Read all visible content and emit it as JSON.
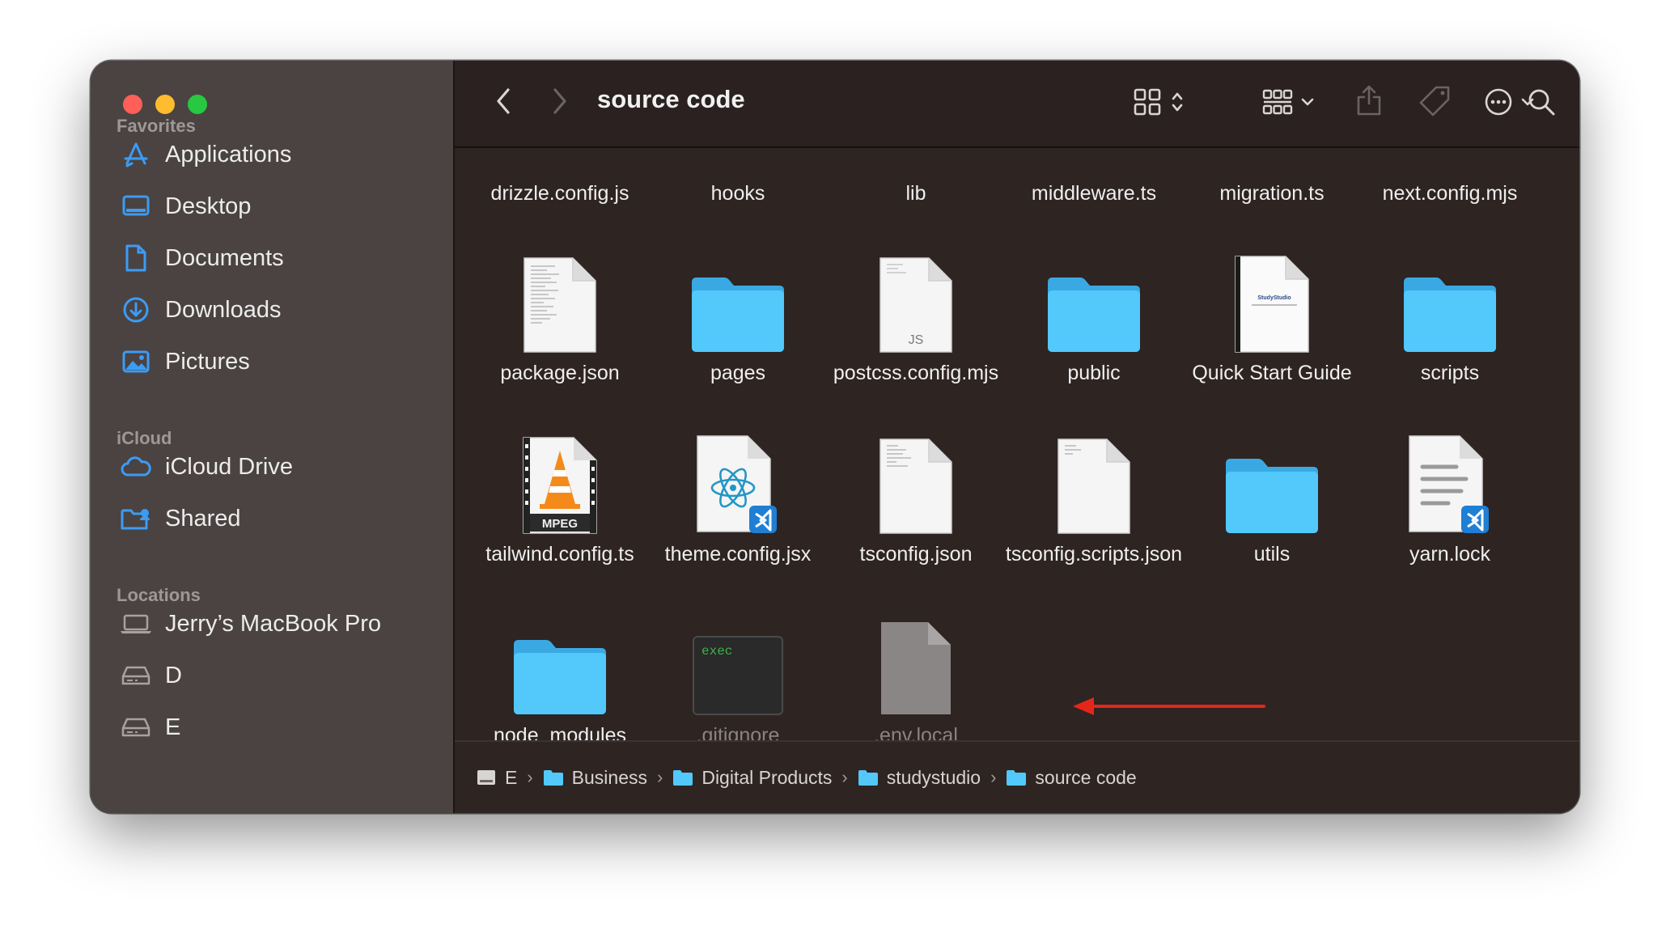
{
  "window": {
    "title": "source code"
  },
  "sidebar": {
    "sections": [
      {
        "heading": "Favorites",
        "items": [
          {
            "label": "Applications",
            "icon": "applications-icon"
          },
          {
            "label": "Desktop",
            "icon": "desktop-icon"
          },
          {
            "label": "Documents",
            "icon": "documents-icon"
          },
          {
            "label": "Downloads",
            "icon": "downloads-icon"
          },
          {
            "label": "Pictures",
            "icon": "pictures-icon"
          }
        ]
      },
      {
        "heading": "iCloud",
        "items": [
          {
            "label": "iCloud Drive",
            "icon": "icloud-icon"
          },
          {
            "label": "Shared",
            "icon": "shared-folder-icon"
          }
        ]
      },
      {
        "heading": "Locations",
        "items": [
          {
            "label": "Jerry’s MacBook Pro",
            "icon": "laptop-icon"
          },
          {
            "label": "D",
            "icon": "drive-icon"
          },
          {
            "label": "E",
            "icon": "drive-icon"
          }
        ]
      }
    ]
  },
  "files": {
    "row0": [
      "drizzle.config.js",
      "hooks",
      "lib",
      "middleware.ts",
      "migration.ts",
      "next.config.mjs"
    ],
    "row1": [
      {
        "name": "package.json",
        "kind": "text-document"
      },
      {
        "name": "pages",
        "kind": "folder"
      },
      {
        "name": "postcss.config.mjs",
        "kind": "js-document",
        "badge": "JS"
      },
      {
        "name": "public",
        "kind": "folder"
      },
      {
        "name": "Quick Start Guide",
        "kind": "pdf-preview",
        "preview_text": "StudyStudio"
      },
      {
        "name": "scripts",
        "kind": "folder"
      }
    ],
    "row2": [
      {
        "name": "tailwind.config.ts",
        "kind": "mpeg-video",
        "badge": "MPEG"
      },
      {
        "name": "theme.config.jsx",
        "kind": "react-file"
      },
      {
        "name": "tsconfig.json",
        "kind": "text-document"
      },
      {
        "name": "tsconfig.scripts.json",
        "kind": "text-document"
      },
      {
        "name": "utils",
        "kind": "folder"
      },
      {
        "name": "yarn.lock",
        "kind": "vscode-document"
      }
    ],
    "row3": [
      {
        "name": "node_modules",
        "kind": "folder"
      },
      {
        "name": ".gitignore",
        "kind": "exec",
        "badge": "exec"
      },
      {
        "name": ".env.local",
        "kind": "hidden-document"
      }
    ]
  },
  "pathbar": {
    "crumbs": [
      "E",
      "Business",
      "Digital Products",
      "studystudio",
      "source code"
    ]
  },
  "colors": {
    "folder": "#52c8fb",
    "accent": "#3b9cf5",
    "arrow": "#e3271b"
  }
}
